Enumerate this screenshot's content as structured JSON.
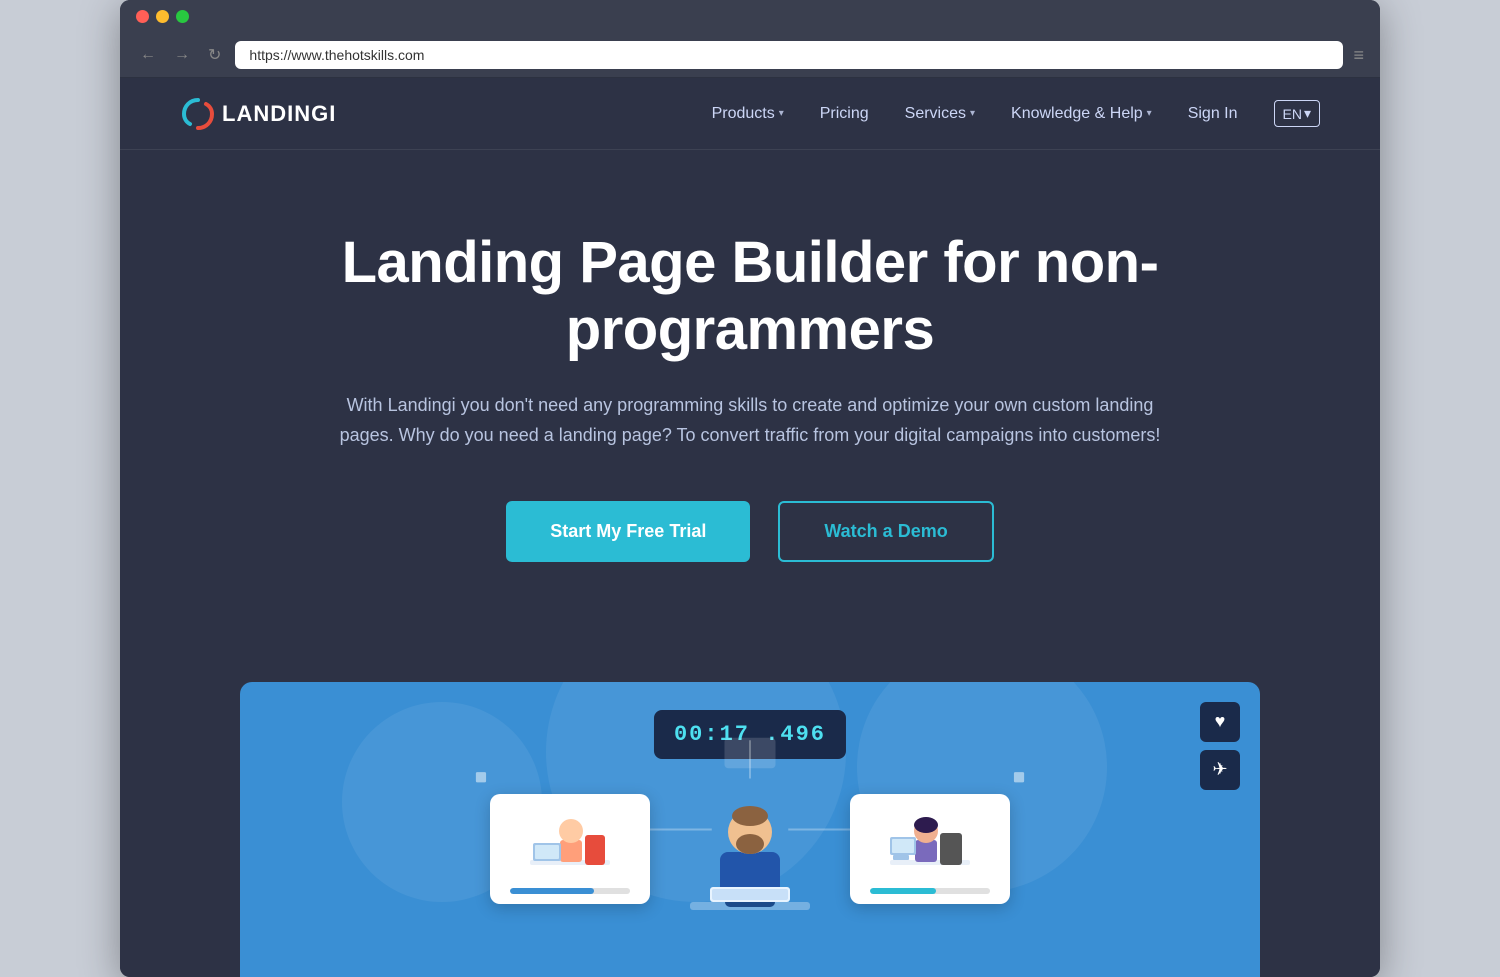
{
  "browser": {
    "url": "https://www.thehotskills.com",
    "nav_back": "←",
    "nav_forward": "→",
    "nav_refresh": "↻",
    "menu": "≡"
  },
  "nav": {
    "logo_text": "LANDINGI",
    "items": [
      {
        "label": "Products",
        "has_dropdown": true
      },
      {
        "label": "Pricing",
        "has_dropdown": false
      },
      {
        "label": "Services",
        "has_dropdown": true
      },
      {
        "label": "Knowledge & Help",
        "has_dropdown": true
      }
    ],
    "sign_in": "Sign In",
    "lang": "EN",
    "lang_arrow": "▾"
  },
  "hero": {
    "title": "Landing Page Builder for non-programmers",
    "subtitle": "With Landingi you don't need any programming skills to create and optimize your own custom landing pages. Why do you need a landing page? To convert traffic from your digital campaigns into customers!",
    "cta_primary": "Start My Free Trial",
    "cta_secondary": "Watch a Demo"
  },
  "demo": {
    "timer": "00:17 .496",
    "heart_icon": "♥",
    "send_icon": "✈"
  },
  "colors": {
    "bg_dark": "#2d3245",
    "accent_cyan": "#2bbcd4",
    "accent_blue": "#3a8fd4",
    "nav_text": "#ccd6f6",
    "timer_bg": "#1a2a4a",
    "timer_text": "#4ee0f0"
  }
}
